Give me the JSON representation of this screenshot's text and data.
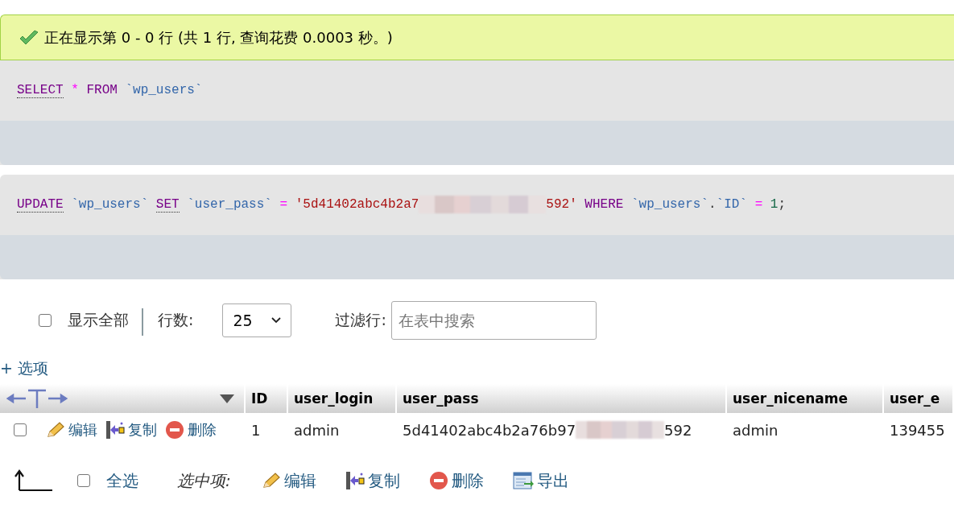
{
  "message": {
    "text": "正在显示第 0 - 0 行 (共 1 行, 查询花费 0.0003 秒。)"
  },
  "queries": [
    {
      "tokens": [
        {
          "kind": "keyword",
          "text": "SELECT",
          "linked": true
        },
        {
          "kind": "operator",
          "text": "*"
        },
        {
          "kind": "keyword",
          "text": "FROM",
          "linked": false
        },
        {
          "kind": "identifier",
          "text": "`wp_users`"
        }
      ]
    },
    {
      "tokens": [
        {
          "kind": "keyword",
          "text": "UPDATE",
          "linked": true
        },
        {
          "kind": "identifier",
          "text": "`wp_users`"
        },
        {
          "kind": "keyword",
          "text": "SET",
          "linked": true
        },
        {
          "kind": "identifier",
          "text": "`user_pass`"
        },
        {
          "kind": "operator",
          "text": "="
        },
        {
          "kind": "string",
          "text": "'5d41402abc4b2a7"
        },
        {
          "kind": "redacted"
        },
        {
          "kind": "string",
          "text": "592'",
          "joined": true
        },
        {
          "kind": "keyword",
          "text": "WHERE",
          "linked": false
        },
        {
          "kind": "identifier",
          "text": "`wp_users`"
        },
        {
          "kind": "plain",
          "text": ".",
          "joined": true
        },
        {
          "kind": "identifier",
          "text": "`ID`",
          "joined": true
        },
        {
          "kind": "operator",
          "text": "="
        },
        {
          "kind": "number",
          "text": "1"
        },
        {
          "kind": "plain",
          "text": ";",
          "joined": true
        }
      ]
    }
  ],
  "controls": {
    "show_all": {
      "label": "显示全部",
      "checked": false
    },
    "rows": {
      "label": "行数:",
      "value": "25"
    },
    "filter": {
      "label": "过滤行:",
      "placeholder": "在表中搜索"
    }
  },
  "options_link": "+ 选项",
  "table": {
    "columns": [
      "ID",
      "user_login",
      "user_pass",
      "user_nicename",
      "user_e"
    ],
    "rows": [
      {
        "checked": false,
        "actions": [
          {
            "kind": "edit",
            "label": "编辑"
          },
          {
            "kind": "copy",
            "label": "复制"
          },
          {
            "kind": "delete",
            "label": "删除"
          }
        ],
        "cells": [
          {
            "parts": [
              {
                "kind": "text",
                "text": "1"
              }
            ]
          },
          {
            "parts": [
              {
                "kind": "text",
                "text": "admin"
              }
            ]
          },
          {
            "parts": [
              {
                "kind": "text",
                "text": "5d41402abc4b2a76b97"
              },
              {
                "kind": "redacted"
              },
              {
                "kind": "text",
                "text": "592"
              }
            ]
          },
          {
            "parts": [
              {
                "kind": "text",
                "text": "admin"
              }
            ]
          },
          {
            "parts": [
              {
                "kind": "text",
                "text": "139455"
              }
            ]
          }
        ]
      }
    ]
  },
  "bulk": {
    "check_all": {
      "label": "全选",
      "checked": false
    },
    "with_selected": "选中项:",
    "actions": [
      {
        "kind": "edit",
        "label": "编辑"
      },
      {
        "kind": "copy",
        "label": "复制"
      },
      {
        "kind": "delete",
        "label": "删除"
      },
      {
        "kind": "export",
        "label": "导出"
      }
    ]
  }
}
